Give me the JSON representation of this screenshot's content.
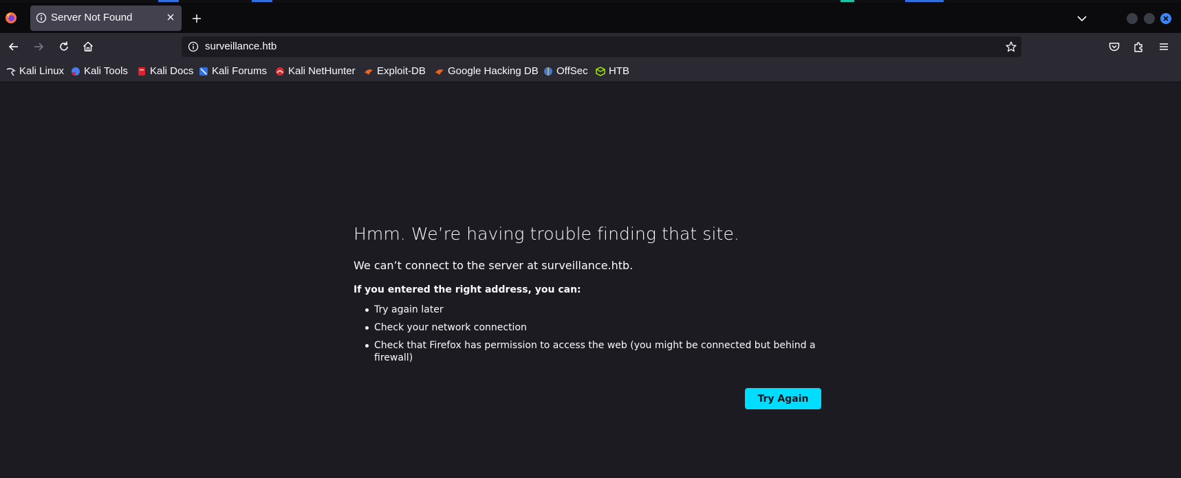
{
  "tab": {
    "title": "Server Not Found"
  },
  "urlbar": {
    "url": "surveillance.htb"
  },
  "bookmarks": [
    {
      "label": "Kali Linux",
      "icon": "kali-linux-icon",
      "color": "#e0e0e6"
    },
    {
      "label": "Kali Tools",
      "icon": "kali-tools-icon",
      "color": "#4a7cf0"
    },
    {
      "label": "Kali Docs",
      "icon": "kali-docs-icon",
      "color": "#e0202a"
    },
    {
      "label": "Kali Forums",
      "icon": "kali-forums-icon",
      "color": "#2f6fe0"
    },
    {
      "label": "Kali NetHunter",
      "icon": "kali-nethunter-icon",
      "color": "#d62b2b"
    },
    {
      "label": "Exploit-DB",
      "icon": "exploit-db-icon",
      "color": "#e8641b"
    },
    {
      "label": "Google Hacking DB",
      "icon": "google-hacking-db-icon",
      "color": "#e8641b"
    },
    {
      "label": "OffSec",
      "icon": "offsec-icon",
      "color": "#3a7ad8"
    },
    {
      "label": "HTB",
      "icon": "htb-icon",
      "color": "#9fef00"
    }
  ],
  "error": {
    "title": "Hmm. We’re having trouble finding that site.",
    "description": "We can’t connect to the server at surveillance.htb.",
    "suggestions_heading": "If you entered the right address, you can:",
    "suggestions": [
      "Try again later",
      "Check your network connection",
      "Check that Firefox has permission to access the web (you might be connected but behind a firewall)"
    ],
    "button_label": "Try Again"
  },
  "colors": {
    "accent": "#00ddff",
    "page_background": "#1c1b22",
    "toolbar_background": "#2b2a33"
  }
}
